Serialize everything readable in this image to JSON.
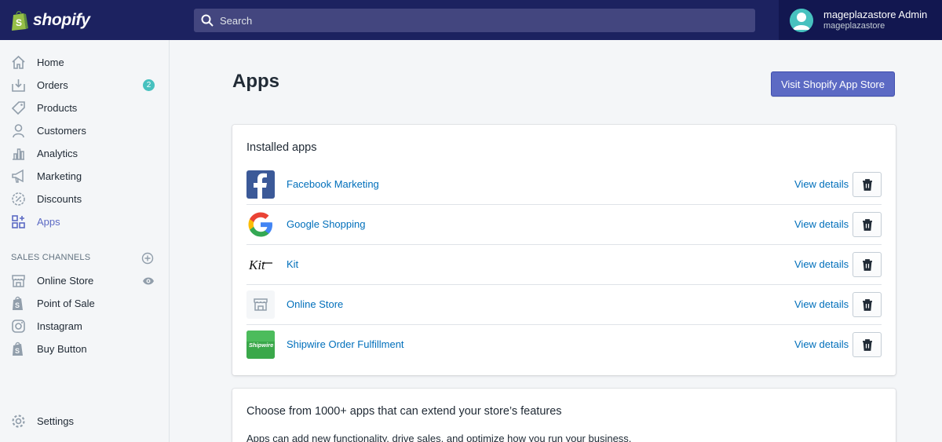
{
  "topbar": {
    "brand": "shopify",
    "search_placeholder": "Search",
    "account_name": "mageplazastore Admin",
    "account_store": "mageplazastore"
  },
  "sidebar": {
    "items": [
      {
        "label": "Home",
        "icon": "home-icon"
      },
      {
        "label": "Orders",
        "icon": "orders-icon",
        "badge": "2"
      },
      {
        "label": "Products",
        "icon": "tag-icon"
      },
      {
        "label": "Customers",
        "icon": "user-icon"
      },
      {
        "label": "Analytics",
        "icon": "bar-chart-icon"
      },
      {
        "label": "Marketing",
        "icon": "megaphone-icon"
      },
      {
        "label": "Discounts",
        "icon": "discount-icon"
      },
      {
        "label": "Apps",
        "icon": "apps-icon",
        "active": true
      }
    ],
    "sales_channels_title": "SALES CHANNELS",
    "channels": [
      {
        "label": "Online Store",
        "icon": "store-icon"
      },
      {
        "label": "Point of Sale",
        "icon": "shopify-bag-icon"
      },
      {
        "label": "Instagram",
        "icon": "instagram-icon"
      },
      {
        "label": "Buy Button",
        "icon": "shopify-bag-icon"
      }
    ],
    "settings_label": "Settings"
  },
  "main": {
    "title": "Apps",
    "visit_button": "Visit Shopify App Store",
    "installed_title": "Installed apps",
    "apps": [
      {
        "name": "Facebook Marketing",
        "logo": "facebook-logo",
        "action": "View details"
      },
      {
        "name": "Google Shopping",
        "logo": "google-logo",
        "action": "View details"
      },
      {
        "name": "Kit",
        "logo": "kit-logo",
        "logo_text": "Kit",
        "action": "View details"
      },
      {
        "name": "Online Store",
        "logo": "store-logo",
        "action": "View details"
      },
      {
        "name": "Shipwire Order Fulfillment",
        "logo": "shipwire-logo",
        "logo_text": "Shipwire",
        "action": "View details"
      }
    ],
    "extend_title": "Choose from 1000+ apps that can extend your store’s features",
    "extend_text": "Apps can add new functionality, drive sales, and optimize how you run your business."
  },
  "colors": {
    "topbar": "#1c2260",
    "accent": "#5c6ac4",
    "link": "#006fbb",
    "badge": "#47c1bf"
  }
}
